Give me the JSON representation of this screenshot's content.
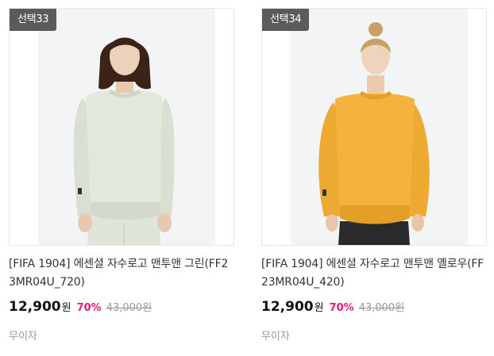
{
  "products": [
    {
      "badge": "선택33",
      "name": "[FIFA 1904] 에센셜 자수로고 맨투맨 그린(FF23MR04U_720)",
      "price": "12,900",
      "currency": "원",
      "discount": "70%",
      "original_price": "43,000원",
      "shipping": "무이자",
      "sweater_color": "#e3e8dd",
      "sweater_shade": "#d2d8cb",
      "pants_color": "#e0e5da",
      "hair_color": "#3a2418"
    },
    {
      "badge": "선택34",
      "name": "[FIFA 1904] 에센셜 자수로고 맨투맨 옐로우(FF23MR04U_420)",
      "price": "12,900",
      "currency": "원",
      "discount": "70%",
      "original_price": "43,000원",
      "shipping": "무이자",
      "sweater_color": "#f3b33c",
      "sweater_shade": "#e39f27",
      "pants_color": "#2a2a2c",
      "hair_color": "#c8a06a"
    }
  ],
  "colors": {
    "badge_bg": "#5b5b5b",
    "discount": "#e8177a",
    "muted": "#999999"
  }
}
